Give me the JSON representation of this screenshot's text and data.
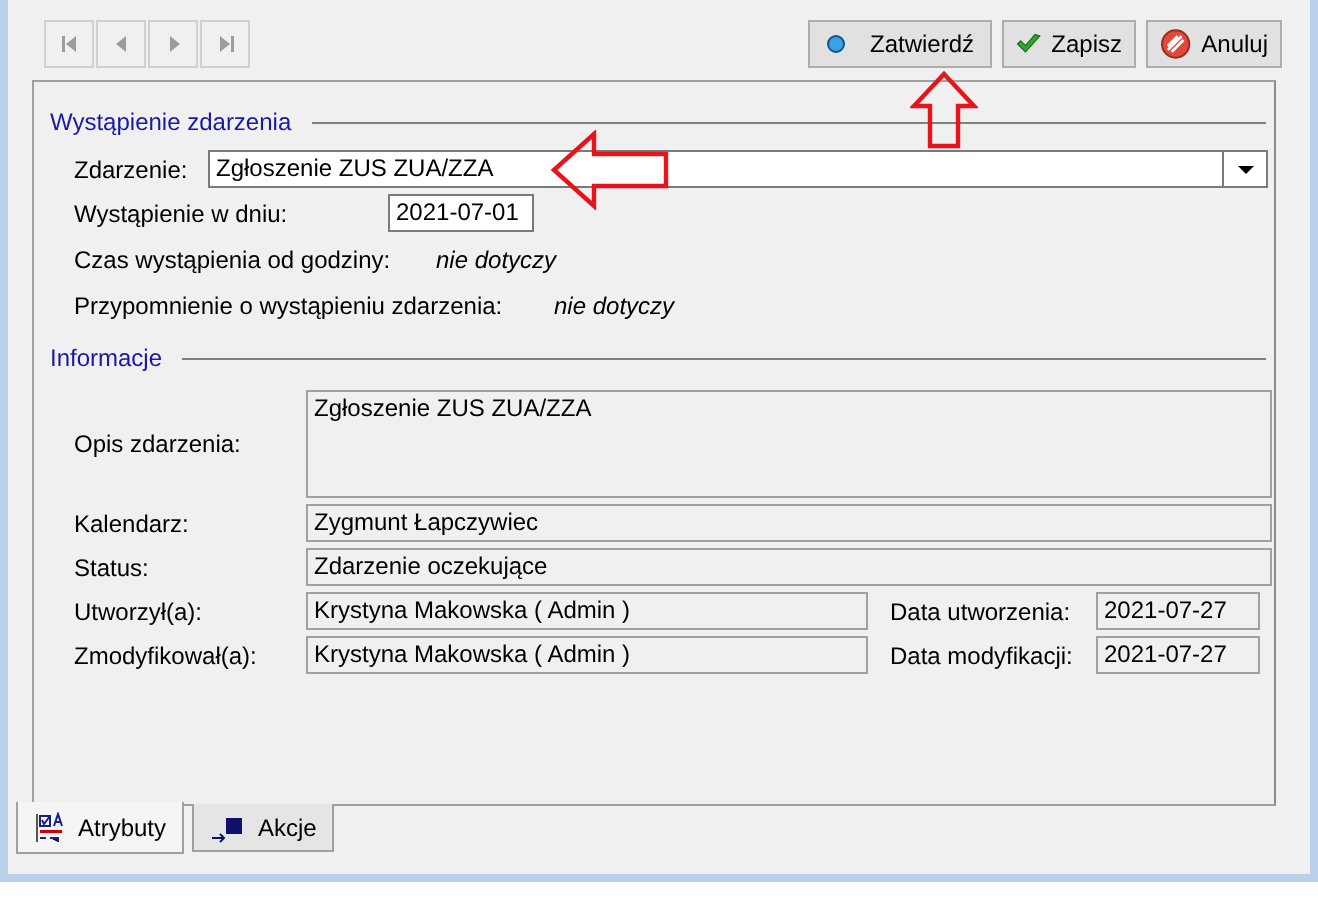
{
  "toolbar": {
    "buttons": [
      {
        "label": "Zatwierdź",
        "kind": "confirm"
      },
      {
        "label": "Zapisz",
        "kind": "save"
      },
      {
        "label": "Anuluj",
        "kind": "cancel"
      }
    ]
  },
  "occurrence": {
    "title": "Wystąpienie zdarzenia",
    "event": {
      "label": "Zdarzenie:",
      "value": "Zgłoszenie ZUS ZUA/ZZA"
    },
    "date": {
      "label": "Wystąpienie w dniu:",
      "value": "2021-07-01"
    },
    "time": {
      "label": "Czas wystąpienia od godziny:",
      "value": "nie dotyczy"
    },
    "reminder": {
      "label": "Przypomnienie o wystąpieniu zdarzenia:",
      "value": "nie dotyczy"
    }
  },
  "information": {
    "title": "Informacje",
    "description": {
      "label": "Opis zdarzenia:",
      "value": "Zgłoszenie ZUS ZUA/ZZA"
    },
    "calendar": {
      "label": "Kalendarz:",
      "value": "Zygmunt Łapczywiec"
    },
    "status": {
      "label": "Status:",
      "value": "Zdarzenie oczekujące"
    },
    "created": {
      "label": "Utworzył(a):",
      "value": "Krystyna Makowska ( Admin )",
      "date_label": "Data utworzenia:",
      "date_value": "2021-07-27"
    },
    "modified": {
      "label": "Zmodyfikował(a):",
      "value": "Krystyna Makowska ( Admin )",
      "date_label": "Data modyfikacji:",
      "date_value": "2021-07-27"
    }
  },
  "tabs": [
    {
      "label": "Atrybuty",
      "kind": "attributes",
      "selected": true
    },
    {
      "label": "Akcje",
      "kind": "actions",
      "selected": false
    }
  ]
}
